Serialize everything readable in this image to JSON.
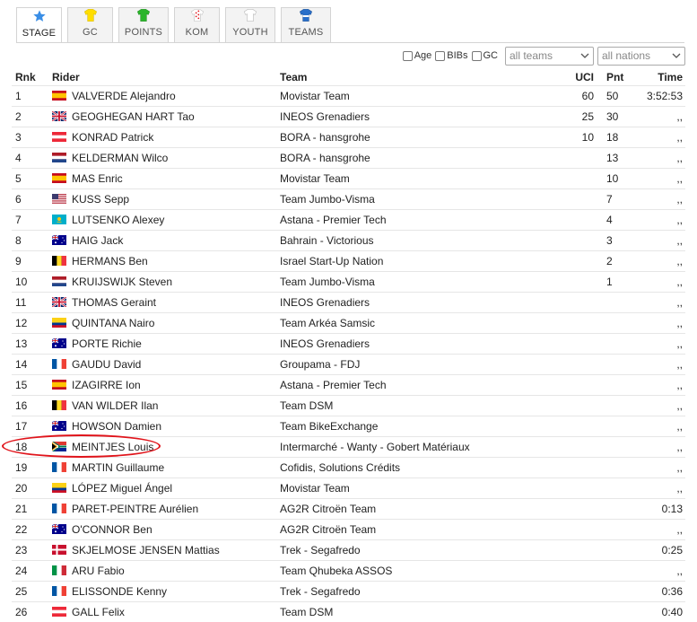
{
  "tabs": [
    {
      "label": "STAGE",
      "icon": "star-icon",
      "active": true
    },
    {
      "label": "GC",
      "icon": "yellow-jersey-icon"
    },
    {
      "label": "POINTS",
      "icon": "green-jersey-icon"
    },
    {
      "label": "KOM",
      "icon": "polka-dot-jersey-icon"
    },
    {
      "label": "YOUTH",
      "icon": "white-jersey-icon"
    },
    {
      "label": "TEAMS",
      "icon": "team-jersey-icon"
    }
  ],
  "filters": {
    "age_label": "Age",
    "bibs_label": "BIBs",
    "gc_label": "GC",
    "teams_select": "all teams",
    "nations_select": "all nations"
  },
  "columns": {
    "rnk": "Rnk",
    "rider": "Rider",
    "team": "Team",
    "uci": "UCI",
    "pnt": "Pnt",
    "time": "Time"
  },
  "rows": [
    {
      "rnk": "1",
      "flag": "es",
      "rider": "VALVERDE Alejandro",
      "team": "Movistar Team",
      "uci": "60",
      "pnt": "50",
      "time": "3:52:53"
    },
    {
      "rnk": "2",
      "flag": "gb",
      "rider": "GEOGHEGAN HART Tao",
      "team": "INEOS Grenadiers",
      "uci": "25",
      "pnt": "30",
      "time": ",,"
    },
    {
      "rnk": "3",
      "flag": "at",
      "rider": "KONRAD Patrick",
      "team": "BORA - hansgrohe",
      "uci": "10",
      "pnt": "18",
      "time": ",,"
    },
    {
      "rnk": "4",
      "flag": "nl",
      "rider": "KELDERMAN Wilco",
      "team": "BORA - hansgrohe",
      "uci": "",
      "pnt": "13",
      "time": ",,"
    },
    {
      "rnk": "5",
      "flag": "es",
      "rider": "MAS Enric",
      "team": "Movistar Team",
      "uci": "",
      "pnt": "10",
      "time": ",,"
    },
    {
      "rnk": "6",
      "flag": "us",
      "rider": "KUSS Sepp",
      "team": "Team Jumbo-Visma",
      "uci": "",
      "pnt": "7",
      "time": ",,"
    },
    {
      "rnk": "7",
      "flag": "kz",
      "rider": "LUTSENKO Alexey",
      "team": "Astana - Premier Tech",
      "uci": "",
      "pnt": "4",
      "time": ",,"
    },
    {
      "rnk": "8",
      "flag": "au",
      "rider": "HAIG Jack",
      "team": "Bahrain - Victorious",
      "uci": "",
      "pnt": "3",
      "time": ",,"
    },
    {
      "rnk": "9",
      "flag": "be",
      "rider": "HERMANS Ben",
      "team": "Israel Start-Up Nation",
      "uci": "",
      "pnt": "2",
      "time": ",,"
    },
    {
      "rnk": "10",
      "flag": "nl",
      "rider": "KRUIJSWIJK Steven",
      "team": "Team Jumbo-Visma",
      "uci": "",
      "pnt": "1",
      "time": ",,"
    },
    {
      "rnk": "11",
      "flag": "gb",
      "rider": "THOMAS Geraint",
      "team": "INEOS Grenadiers",
      "uci": "",
      "pnt": "",
      "time": ",,"
    },
    {
      "rnk": "12",
      "flag": "co",
      "rider": "QUINTANA Nairo",
      "team": "Team Arkéa Samsic",
      "uci": "",
      "pnt": "",
      "time": ",,"
    },
    {
      "rnk": "13",
      "flag": "au",
      "rider": "PORTE Richie",
      "team": "INEOS Grenadiers",
      "uci": "",
      "pnt": "",
      "time": ",,"
    },
    {
      "rnk": "14",
      "flag": "fr",
      "rider": "GAUDU David",
      "team": "Groupama - FDJ",
      "uci": "",
      "pnt": "",
      "time": ",,"
    },
    {
      "rnk": "15",
      "flag": "es",
      "rider": "IZAGIRRE Ion",
      "team": "Astana - Premier Tech",
      "uci": "",
      "pnt": "",
      "time": ",,"
    },
    {
      "rnk": "16",
      "flag": "be",
      "rider": "VAN WILDER Ilan",
      "team": "Team DSM",
      "uci": "",
      "pnt": "",
      "time": ",,"
    },
    {
      "rnk": "17",
      "flag": "au",
      "rider": "HOWSON Damien",
      "team": "Team BikeExchange",
      "uci": "",
      "pnt": "",
      "time": ",,"
    },
    {
      "rnk": "18",
      "flag": "za",
      "rider": "MEINTJES Louis",
      "team": "Intermarché - Wanty - Gobert Matériaux",
      "uci": "",
      "pnt": "",
      "time": ",,"
    },
    {
      "rnk": "19",
      "flag": "fr",
      "rider": "MARTIN Guillaume",
      "team": "Cofidis, Solutions Crédits",
      "uci": "",
      "pnt": "",
      "time": ",,"
    },
    {
      "rnk": "20",
      "flag": "co",
      "rider": "LÓPEZ Miguel Ángel",
      "team": "Movistar Team",
      "uci": "",
      "pnt": "",
      "time": ",,"
    },
    {
      "rnk": "21",
      "flag": "fr",
      "rider": "PARET-PEINTRE Aurélien",
      "team": "AG2R Citroën Team",
      "uci": "",
      "pnt": "",
      "time": "0:13"
    },
    {
      "rnk": "22",
      "flag": "au",
      "rider": "O'CONNOR Ben",
      "team": "AG2R Citroën Team",
      "uci": "",
      "pnt": "",
      "time": ",,"
    },
    {
      "rnk": "23",
      "flag": "dk",
      "rider": "SKJELMOSE JENSEN Mattias",
      "team": "Trek - Segafredo",
      "uci": "",
      "pnt": "",
      "time": "0:25"
    },
    {
      "rnk": "24",
      "flag": "it",
      "rider": "ARU Fabio",
      "team": "Team Qhubeka ASSOS",
      "uci": "",
      "pnt": "",
      "time": ",,"
    },
    {
      "rnk": "25",
      "flag": "fr",
      "rider": "ELISSONDE Kenny",
      "team": "Trek - Segafredo",
      "uci": "",
      "pnt": "",
      "time": "0:36"
    },
    {
      "rnk": "26",
      "flag": "at",
      "rider": "GALL Felix",
      "team": "Team DSM",
      "uci": "",
      "pnt": "",
      "time": "0:40"
    }
  ],
  "colors": {
    "highlight_circle": "#e0141b",
    "tab_star": "#3a8ee6"
  }
}
